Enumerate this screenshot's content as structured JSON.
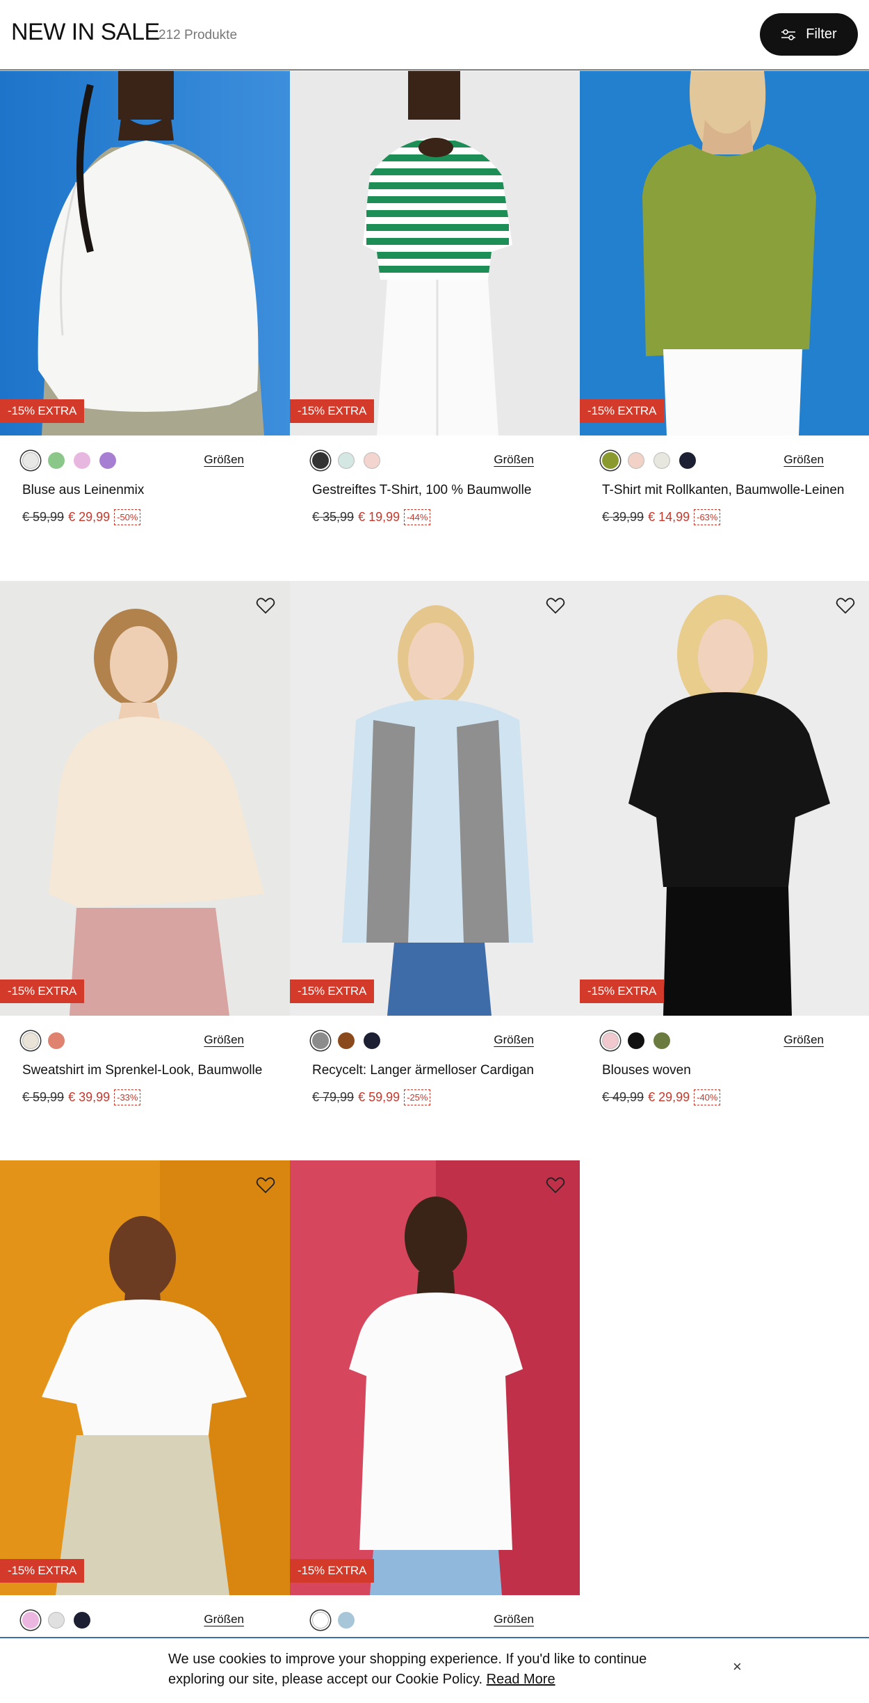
{
  "header": {
    "title": "NEW IN SALE",
    "count": "212 Produkte",
    "filter_label": "Filter"
  },
  "products": [
    {
      "name": "Bluse aus Leinenmix",
      "old_price": "€ 59,99",
      "new_price": "€ 29,99",
      "discount": "-50%",
      "badge": "-15% EXTRA",
      "sizes": "Größen",
      "swatches": [
        "#e8e8e6",
        "#8cc78a",
        "#e8b7e0",
        "#a77fd2"
      ],
      "scene": "blue-white-blouse"
    },
    {
      "name": "Gestreiftes T-Shirt, 100 % Baumwolle",
      "old_price": "€ 35,99",
      "new_price": "€ 19,99",
      "discount": "-44%",
      "badge": "-15% EXTRA",
      "sizes": "Größen",
      "swatches": [
        "#333333",
        "#d4e7e3",
        "#f4d4cf"
      ],
      "scene": "green-stripes"
    },
    {
      "name": "T-Shirt mit Rollkanten, Baumwolle-Leinen",
      "old_price": "€ 39,99",
      "new_price": "€ 14,99",
      "discount": "-63%",
      "badge": "-15% EXTRA",
      "sizes": "Größen",
      "swatches": [
        "#8b9a2f",
        "#f2d2c6",
        "#e7e6df",
        "#1d1f33"
      ],
      "scene": "olive-tee"
    },
    {
      "name": "Sweatshirt im Sprenkel-Look, Baumwolle",
      "old_price": "€ 59,99",
      "new_price": "€ 39,99",
      "discount": "-33%",
      "badge": "-15% EXTRA",
      "sizes": "Größen",
      "swatches": [
        "#e9e3d8",
        "#e08270"
      ],
      "scene": "cream-sweat"
    },
    {
      "name": "Recycelt: Langer ärmelloser Cardigan",
      "old_price": "€ 79,99",
      "new_price": "€ 59,99",
      "discount": "-25%",
      "badge": "-15% EXTRA",
      "sizes": "Größen",
      "swatches": [
        "#8c8c8c",
        "#8a4a1c",
        "#1d1f33"
      ],
      "scene": "grey-cardigan"
    },
    {
      "name": "Blouses woven",
      "old_price": "€ 49,99",
      "new_price": "€ 29,99",
      "discount": "-40%",
      "badge": "-15% EXTRA",
      "sizes": "Größen",
      "swatches": [
        "#f2c8cf",
        "#111111",
        "#6b7a3f"
      ],
      "scene": "black-blouse"
    },
    {
      "name": "",
      "old_price": "",
      "new_price": "",
      "discount": "",
      "badge": "-15% EXTRA",
      "sizes": "Größen",
      "swatches": [
        "#ebb6df",
        "#e0e0e0",
        "#1d1f33"
      ],
      "scene": "orange-eyelet"
    },
    {
      "name": "",
      "old_price": "",
      "new_price": "",
      "discount": "",
      "badge": "-15% EXTRA",
      "sizes": "Größen",
      "swatches": [
        "#ffffff",
        "#a7c6d8"
      ],
      "scene": "red-white-top"
    }
  ],
  "cookie": {
    "text": "We use cookies to improve your shopping experience. If you'd like to continue exploring our site, please accept our Cookie Policy.",
    "link": "Read More",
    "close": "×"
  },
  "colors": {
    "badge": "#d43a2a",
    "sale_price": "#c8372a",
    "cookie_border": "#3b6fa8"
  },
  "icons": {
    "filter": "sliders-icon",
    "wishlist": "heart-icon",
    "close": "close-icon"
  }
}
